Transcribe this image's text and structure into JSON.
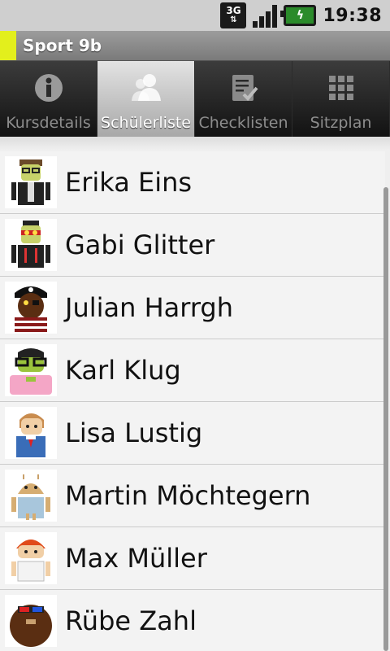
{
  "status_bar": {
    "network_label": "3G",
    "time": "19:38",
    "icons": [
      "network-3g-icon",
      "signal-icon",
      "battery-charging-icon"
    ]
  },
  "title_bar": {
    "title": "Sport 9b",
    "accent_color": "#e3ef1c"
  },
  "tabs": [
    {
      "label": "Kursdetails",
      "icon": "info-icon",
      "selected": false
    },
    {
      "label": "Schülerliste",
      "icon": "people-icon",
      "selected": true
    },
    {
      "label": "Checklisten",
      "icon": "checklist-icon",
      "selected": false
    },
    {
      "label": "Sitzplan",
      "icon": "grid-icon",
      "selected": false
    }
  ],
  "students": [
    {
      "name": "Erika Eins",
      "avatar": "avatar-erika-icon"
    },
    {
      "name": "Gabi Glitter",
      "avatar": "avatar-gabi-icon"
    },
    {
      "name": "Julian Harrgh",
      "avatar": "avatar-julian-pirate-icon"
    },
    {
      "name": "Karl Klug",
      "avatar": "avatar-karl-icon"
    },
    {
      "name": "Lisa Lustig",
      "avatar": "avatar-lisa-icon"
    },
    {
      "name": "Martin Möchtegern",
      "avatar": "avatar-martin-icon"
    },
    {
      "name": "Max Müller",
      "avatar": "avatar-max-icon"
    },
    {
      "name": "Rübe Zahl",
      "avatar": "avatar-ruebe-icon"
    }
  ]
}
